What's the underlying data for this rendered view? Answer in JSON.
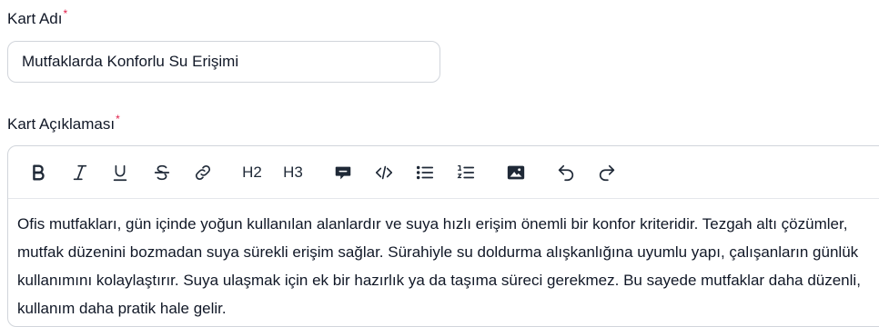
{
  "form": {
    "name_label": "Kart Adı",
    "name_required": "*",
    "name_value": "Mutfaklarda Konforlu Su Erişimi",
    "desc_label": "Kart Açıklaması",
    "desc_required": "*"
  },
  "toolbar": {
    "heading2": "H2",
    "heading3": "H3",
    "icons": [
      "bold-icon",
      "italic-icon",
      "underline-icon",
      "strikethrough-icon",
      "link-icon",
      "heading2",
      "heading3",
      "comment-icon",
      "code-icon",
      "bullet-list-icon",
      "numbered-list-icon",
      "image-icon",
      "undo-icon",
      "redo-icon"
    ]
  },
  "editor": {
    "text": "Ofis mutfakları, gün içinde yoğun kullanılan alanlardır ve suya hızlı erişim önemli bir konfor kriteridir. Tezgah altı çözümler, mutfak düzenini bozmadan suya sürekli erişim sağlar. Sürahiyle su doldurma alışkanlığına uyumlu yapı, çalışanların günlük kullanımını kolaylaştırır. Suya ulaşmak için ek bir hazırlık ya da taşıma süreci gerekmez. Bu sayede mutfaklar daha düzenli, kullanım daha pratik hale gelir."
  }
}
